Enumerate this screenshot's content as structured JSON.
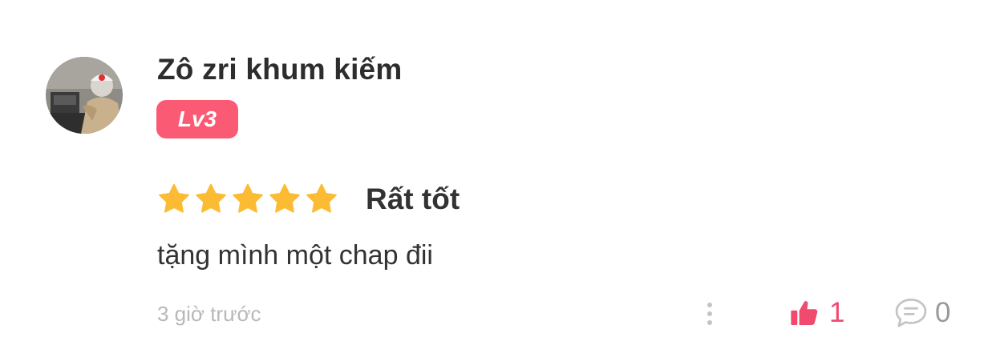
{
  "review": {
    "user": {
      "name": "Zô zri khum kiếm",
      "level": "Lv3",
      "avatar": "user-avatar-photo"
    },
    "rating": {
      "stars": 5,
      "max_stars": 5,
      "label": "Rất tốt"
    },
    "text": "tặng mình một chap đii",
    "timestamp": "3 giờ trước",
    "actions": {
      "more_icon": "more-vertical-icon",
      "like_icon": "thumbs-up-icon",
      "like_count": "1",
      "comment_icon": "comment-bubble-icon",
      "comment_count": "0"
    }
  },
  "colors": {
    "badge": "#fb5a75",
    "star": "#fbbc34",
    "like": "#f04a6d",
    "muted": "#b8b8b8"
  }
}
